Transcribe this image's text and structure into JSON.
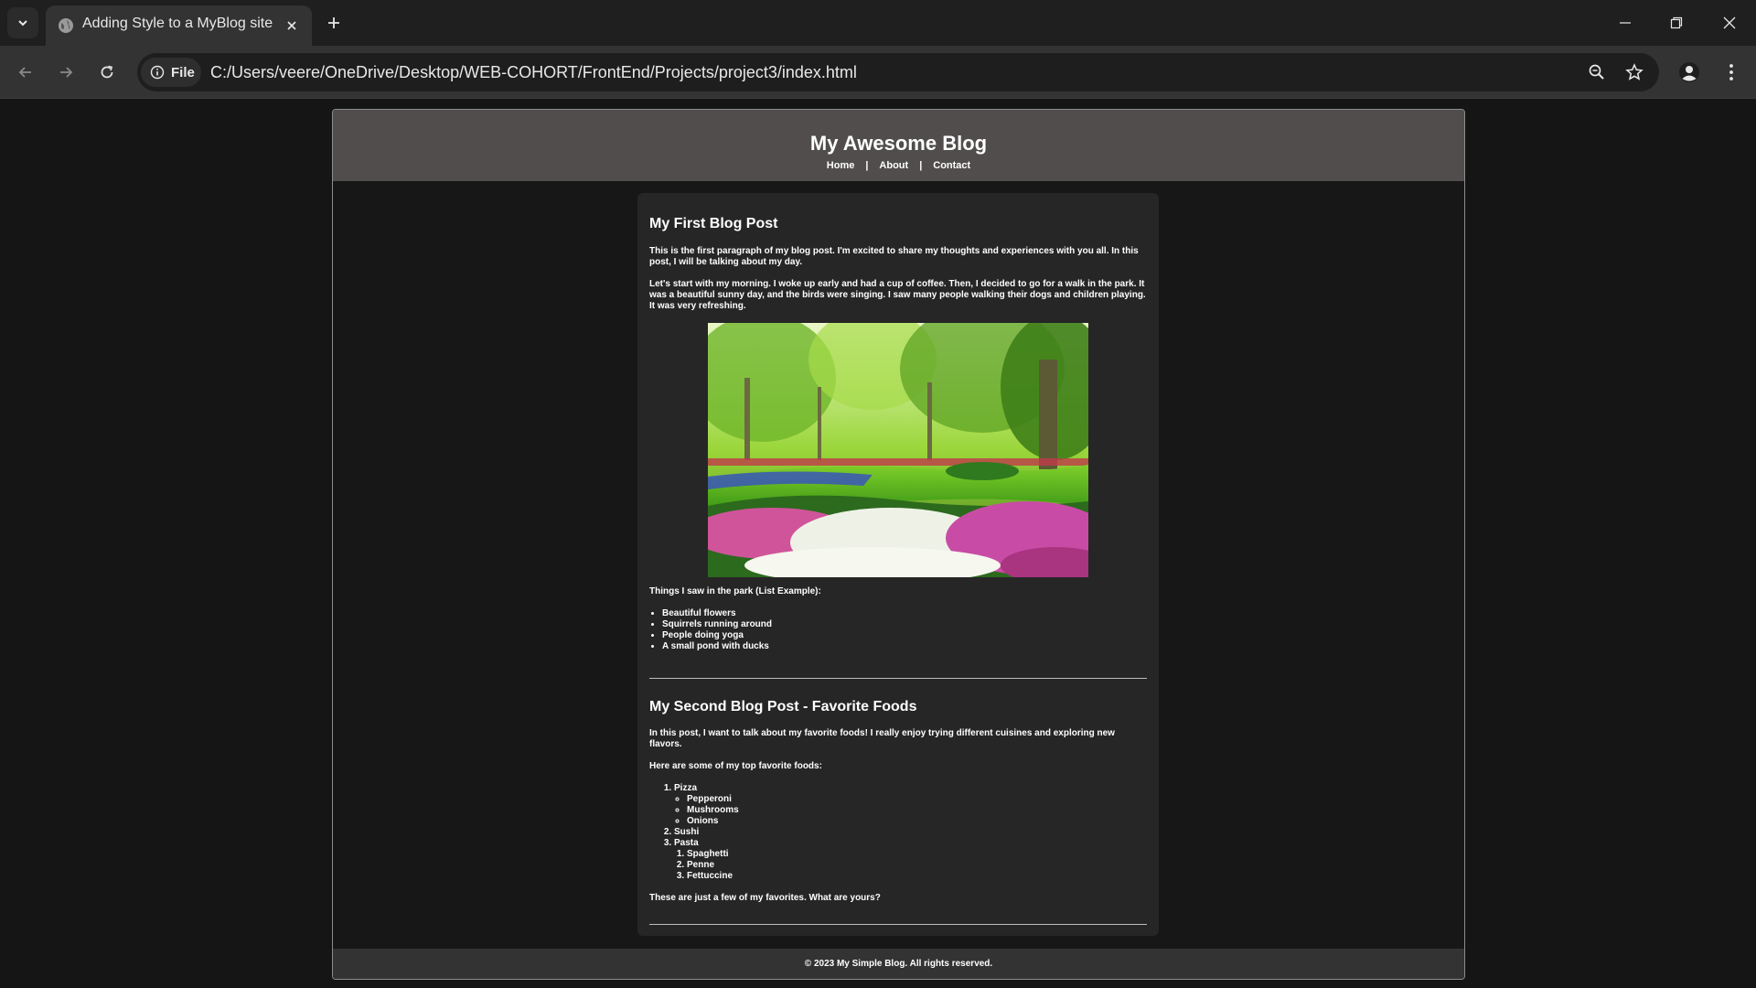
{
  "browser": {
    "tab_title": "Adding Style to a MyBlog site",
    "address_chip": "File",
    "url": "C:/Users/veere/OneDrive/Desktop/WEB-COHORT/FrontEnd/Projects/project3/index.html"
  },
  "site": {
    "title": "My Awesome Blog",
    "nav": [
      "Home",
      "About",
      "Contact"
    ],
    "footer": "© 2023 My Simple Blog. All rights reserved."
  },
  "post1": {
    "title": "My First Blog Post",
    "p1": "This is the first paragraph of my blog post. I'm excited to share my thoughts and experiences with you all. In this post, I will be talking about my day.",
    "p2": "Let's start with my morning. I woke up early and had a cup of coffee. Then, I decided to go for a walk in the park. It was a beautiful sunny day, and the birds were singing. I saw many people walking their dogs and children playing. It was very refreshing.",
    "list_intro": "Things I saw in the park (List Example):",
    "list": [
      "Beautiful flowers",
      "Squirrels running around",
      "People doing yoga",
      "A small pond with ducks"
    ]
  },
  "post2": {
    "title": "My Second Blog Post - Favorite Foods",
    "p1": "In this post, I want to talk about my favorite foods! I really enjoy trying different cuisines and exploring new flavors.",
    "p2": "Here are some of my top favorite foods:",
    "foods": {
      "pizza": "Pizza",
      "pizza_toppings": [
        "Pepperoni",
        "Mushrooms",
        "Onions"
      ],
      "sushi": "Sushi",
      "pasta": "Pasta",
      "pasta_types": [
        "Spaghetti",
        "Penne",
        "Fettuccine"
      ]
    },
    "closing": "These are just a few of my favorites. What are yours?"
  },
  "colors": {
    "header_bg": "#514d4d",
    "content_bg": "#262626",
    "page_bg": "#171717"
  }
}
